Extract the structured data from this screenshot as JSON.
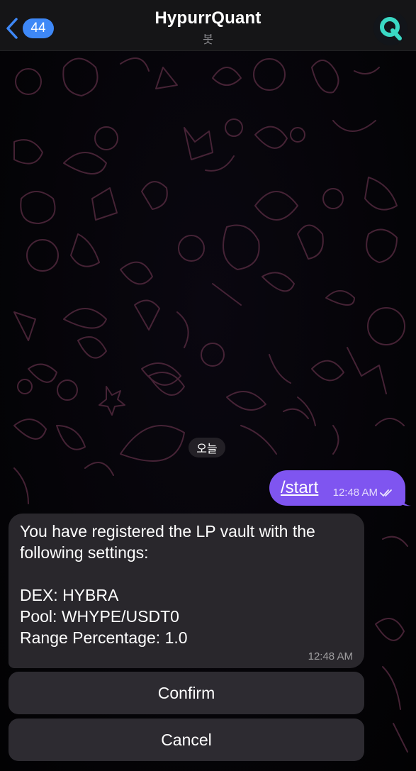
{
  "header": {
    "back_icon": "chevron-left-icon",
    "unread_count": "44",
    "title": "HypurrQuant",
    "subtitle": "봇",
    "avatar_icon": "q-logo-icon",
    "avatar_color": "#3ad8c4"
  },
  "chat": {
    "date_label": "오늘",
    "outgoing": {
      "text": "/start",
      "time": "12:48 AM",
      "status_icon": "double-check-icon",
      "bubble_color": "#7f55f0"
    },
    "incoming": {
      "lines": [
        "You have registered the LP vault with the",
        "following settings:",
        "DEX: HYBRA",
        "Pool: WHYPE/USDT0",
        "Range Percentage: 1.0"
      ],
      "time": "12:48 AM"
    },
    "buttons": {
      "confirm": "Confirm",
      "cancel": "Cancel"
    }
  }
}
